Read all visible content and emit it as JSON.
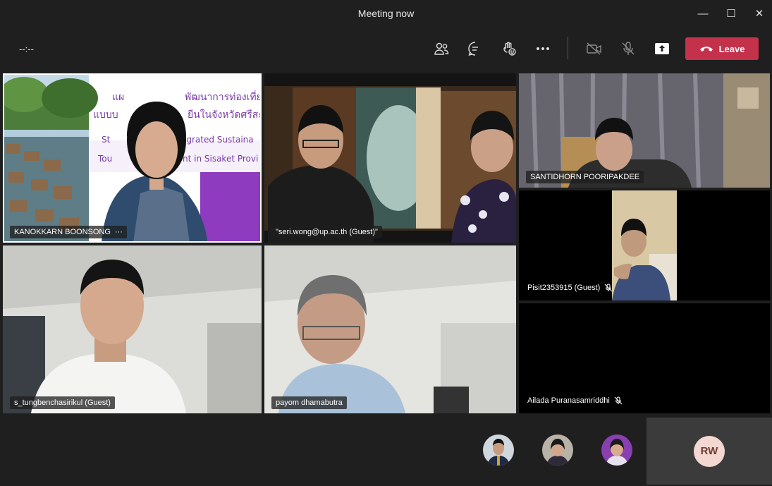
{
  "window": {
    "title": "Meeting now",
    "minimize_glyph": "—",
    "maximize_glyph": "☐",
    "close_glyph": "✕"
  },
  "toolbar": {
    "timer": "--:--",
    "icons": [
      "people-icon",
      "chat-icon",
      "reactions-icon",
      "more-icon",
      "camera-off-icon",
      "mic-off-icon",
      "share-icon"
    ],
    "leave_label": "Leave",
    "leave_color": "#c4314b"
  },
  "participants": [
    {
      "name": "KANOKKARN BOONSONG",
      "extra": "···",
      "slide_text_th": "แผนพัฒนาการท่องเที่ยว แบบบูรณาการยั่งยืนในจังหวัดศรีสะเกษ",
      "slide_text_en": "Strategic Integrated Sustainable Tourism Development in Sisaket Province"
    },
    {
      "name": "\"seri.wong@up.ac.th (Guest)\""
    },
    {
      "name": "SANTIDHORN POORIPAKDEE"
    },
    {
      "name": "Pisit2353915 (Guest)",
      "muted": true
    },
    {
      "name": "s_tungbenchasirikul (Guest)"
    },
    {
      "name": "payom dhamabutra"
    },
    {
      "name": "Ailada Puranasamriddhi",
      "muted": true
    }
  ],
  "self": {
    "initials": "RW"
  }
}
